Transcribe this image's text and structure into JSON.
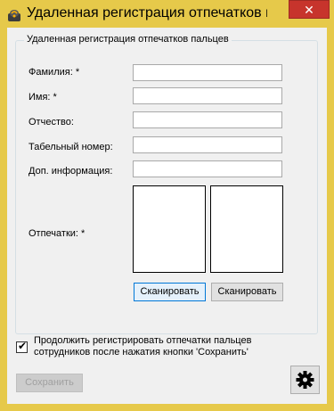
{
  "window": {
    "title": "Удаленная регистрация отпечатков пальцев",
    "close_symbol": "✕"
  },
  "group": {
    "title": "Удаленная регистрация отпечатков пальцев"
  },
  "form": {
    "last_name_label": "Фамилия: *",
    "first_name_label": "Имя: *",
    "middle_name_label": "Отчество:",
    "personnel_number_label": "Табельный номер:",
    "extra_info_label": "Доп. информация:",
    "prints_label": "Отпечатки: *",
    "last_name_value": "",
    "first_name_value": "",
    "middle_name_value": "",
    "personnel_number_value": "",
    "extra_info_value": ""
  },
  "buttons": {
    "scan_left": "Сканировать",
    "scan_right": "Сканировать",
    "save": "Сохранить"
  },
  "options": {
    "continue_checked": true,
    "continue_label": "Продолжить регистрировать отпечатки пальцев сотрудников после нажатия кнопки 'Сохранить'",
    "check_symbol": "✔"
  },
  "icons": {
    "app": "fingerprint-app-icon",
    "settings": "gear-icon"
  }
}
